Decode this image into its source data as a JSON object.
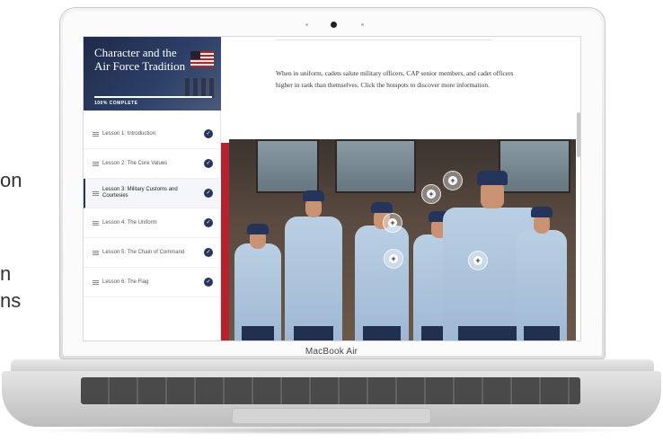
{
  "background_fragments": [
    {
      "text": "on"
    },
    {
      "text": "n"
    },
    {
      "text": "ns"
    }
  ],
  "laptop": {
    "brand_prefix": "MacBook",
    "brand_suffix": " Air"
  },
  "sidebar": {
    "course_title": "Character and the Air Force Tradition",
    "progress_label": "100% COMPLETE",
    "progress_fraction": 1.0,
    "lessons": [
      {
        "label": "Lesson 1: Introduction",
        "completed": true
      },
      {
        "label": "Lesson 2: The Core Values",
        "completed": true
      },
      {
        "label": "Lesson 3: Military Customs and Courtesies",
        "completed": true,
        "active": true
      },
      {
        "label": "Lesson 4: The Uniform",
        "completed": true
      },
      {
        "label": "Lesson 5: The Chain of Command",
        "completed": true
      },
      {
        "label": "Lesson 6: The Flag",
        "completed": true
      }
    ]
  },
  "main": {
    "body_text": "When in uniform, cadets salute military officers, CAP senior members, and cadet officers higher in rank than themselves. Click the hotspots to discover more information.",
    "hotspot_symbol": "+"
  },
  "colors": {
    "sidebar_header": "#26375a",
    "accent_red": "#b2232f",
    "check": "#26375a"
  }
}
